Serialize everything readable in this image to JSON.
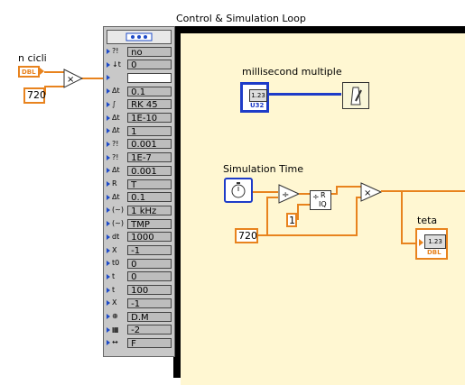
{
  "loop": {
    "title": "Control & Simulation Loop"
  },
  "controls": {
    "n_cicli_label": "n cicli",
    "n_cicli_type": "DBL",
    "constant_720_left": "720",
    "multiply_symbol": "×"
  },
  "params": [
    {
      "icon": "?!",
      "value": "no"
    },
    {
      "icon": "↓t",
      "value": "0"
    },
    {
      "icon": "",
      "value": "",
      "white": true
    },
    {
      "icon": "Δt",
      "value": "0.1"
    },
    {
      "icon": "∫",
      "value": "RK 45"
    },
    {
      "icon": "Δt",
      "value": "1E-10"
    },
    {
      "icon": "Δt",
      "value": "1"
    },
    {
      "icon": "?!",
      "value": "0.001"
    },
    {
      "icon": "?!",
      "value": "1E-7"
    },
    {
      "icon": "Δt",
      "value": "0.001"
    },
    {
      "icon": "R",
      "value": "T"
    },
    {
      "icon": "Δt",
      "value": "0.1"
    },
    {
      "icon": "(~)",
      "value": "1 kHz"
    },
    {
      "icon": "(~)",
      "value": "TMP"
    },
    {
      "icon": "dt",
      "value": "1000"
    },
    {
      "icon": "X",
      "value": "-1"
    },
    {
      "icon": "t0",
      "value": "0"
    },
    {
      "icon": "t",
      "value": "0"
    },
    {
      "icon": "t",
      "value": "100"
    },
    {
      "icon": "X",
      "value": "-1"
    },
    {
      "icon": "⊕",
      "value": "D.M"
    },
    {
      "icon": "▦",
      "value": "-2"
    },
    {
      "icon": "↔",
      "value": "F"
    }
  ],
  "diagram": {
    "ms_label": "millisecond multiple",
    "ms_type": "U32",
    "ms_display": "1.23",
    "sim_time_label": "Simulation Time",
    "divide_symbol": "÷",
    "rq_top": "R",
    "rq_bottom": "IQ",
    "const_1": "1",
    "const_720": "720",
    "multiply_symbol": "×",
    "teta_label": "teta",
    "teta_display": "1.23",
    "teta_type": "DBL"
  }
}
